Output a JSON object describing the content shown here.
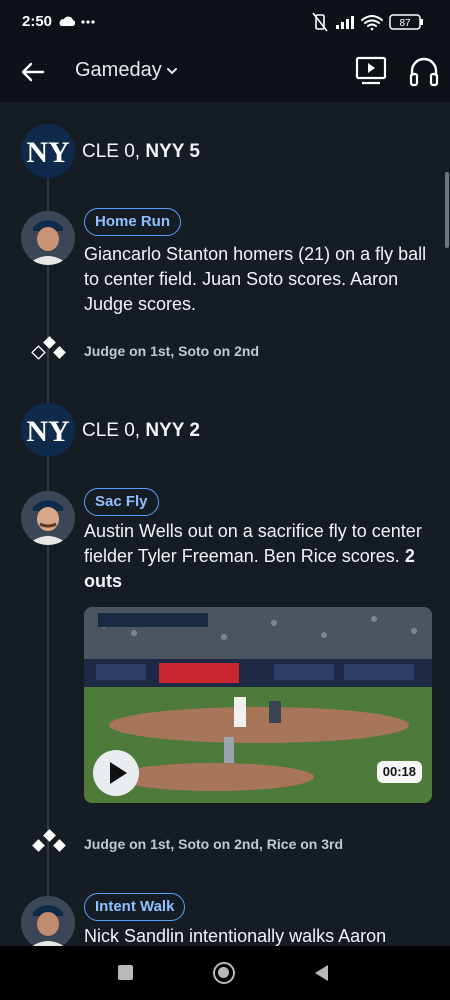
{
  "status": {
    "time": "2:50",
    "battery": "87"
  },
  "header": {
    "title": "Gameday"
  },
  "feed": {
    "events": [
      {
        "type": "score",
        "text_plain": "CLE 0,",
        "text_bold": "NYY 5"
      },
      {
        "type": "play",
        "badge": "Home Run",
        "text": "Giancarlo Stanton homers (21) on a fly ball to center field. Juan Soto scores. Aaron Judge scores.",
        "text_bold": ""
      },
      {
        "type": "runners",
        "text": "Judge on 1st, Soto on 2nd",
        "bases_occupied": [
          "1st",
          "2nd"
        ]
      },
      {
        "type": "score",
        "text_plain": "CLE 0,",
        "text_bold": "NYY 2"
      },
      {
        "type": "play",
        "badge": "Sac Fly",
        "text": "Austin Wells out on a sacrifice fly to center fielder Tyler Freeman. Ben Rice scores.",
        "text_bold": "2 outs",
        "video_duration": "00:18"
      },
      {
        "type": "runners",
        "text": "Judge on 1st, Soto on 2nd, Rice on 3rd",
        "bases_occupied": [
          "1st",
          "2nd",
          "3rd"
        ]
      },
      {
        "type": "play",
        "badge": "Intent Walk",
        "text": "Nick Sandlin intentionally walks Aaron",
        "text_bold": ""
      }
    ]
  },
  "colors": {
    "background": "#151c24",
    "accent": "#5aa0ff",
    "yankees_navy": "#0f2a4a"
  }
}
